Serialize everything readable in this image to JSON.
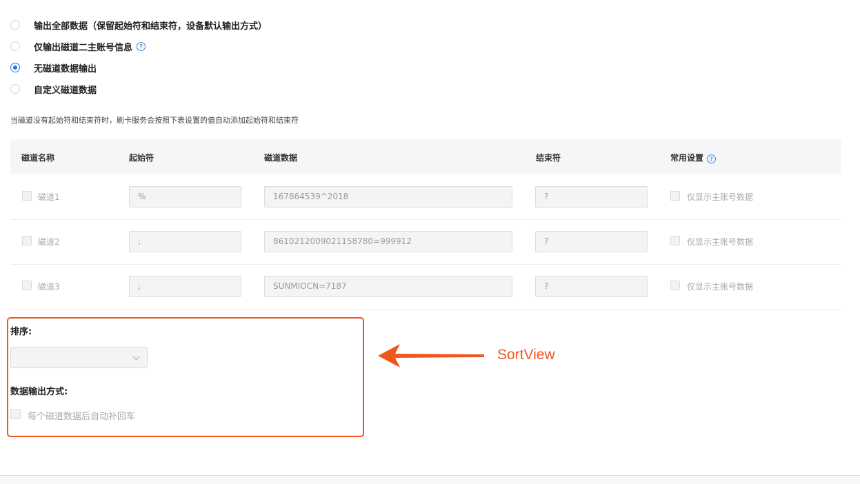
{
  "options": [
    {
      "label": "输出全部数据（保留起始符和结束符，设备默认输出方式）",
      "checked": false
    },
    {
      "label": "仅输出磁道二主账号信息",
      "checked": false,
      "help": "?"
    },
    {
      "label": "无磁道数据输出",
      "checked": true
    },
    {
      "label": "自定义磁道数据",
      "checked": false
    }
  ],
  "note": "当磁道没有起始符和结束符时，刷卡服务会按照下表设置的值自动添加起始符和结束符",
  "table": {
    "headers": {
      "name": "磁道名称",
      "start": "起始符",
      "data": "磁道数据",
      "end": "结束符",
      "common": "常用设置",
      "help": "?"
    },
    "rows": [
      {
        "name": "磁道1",
        "start": "%",
        "data": "167864539^2018",
        "end": "?",
        "option": "仅显示主账号数据"
      },
      {
        "name": "磁道2",
        "start": ";",
        "data": "8610212009021158780=999912",
        "end": "?",
        "option": "仅显示主账号数据"
      },
      {
        "name": "磁道3",
        "start": ";",
        "data": "SUNMIOCN=7187",
        "end": "?",
        "option": "仅显示主账号数据"
      }
    ]
  },
  "sort": {
    "title": "排序:",
    "selected": ""
  },
  "output": {
    "title": "数据输出方式:",
    "checkbox_label": "每个磁道数据后自动补回车"
  },
  "annotation": {
    "label": "SortView",
    "color": "#f0561d"
  },
  "colors": {
    "accent": "#1a7ae8",
    "highlight": "#f0561d"
  }
}
